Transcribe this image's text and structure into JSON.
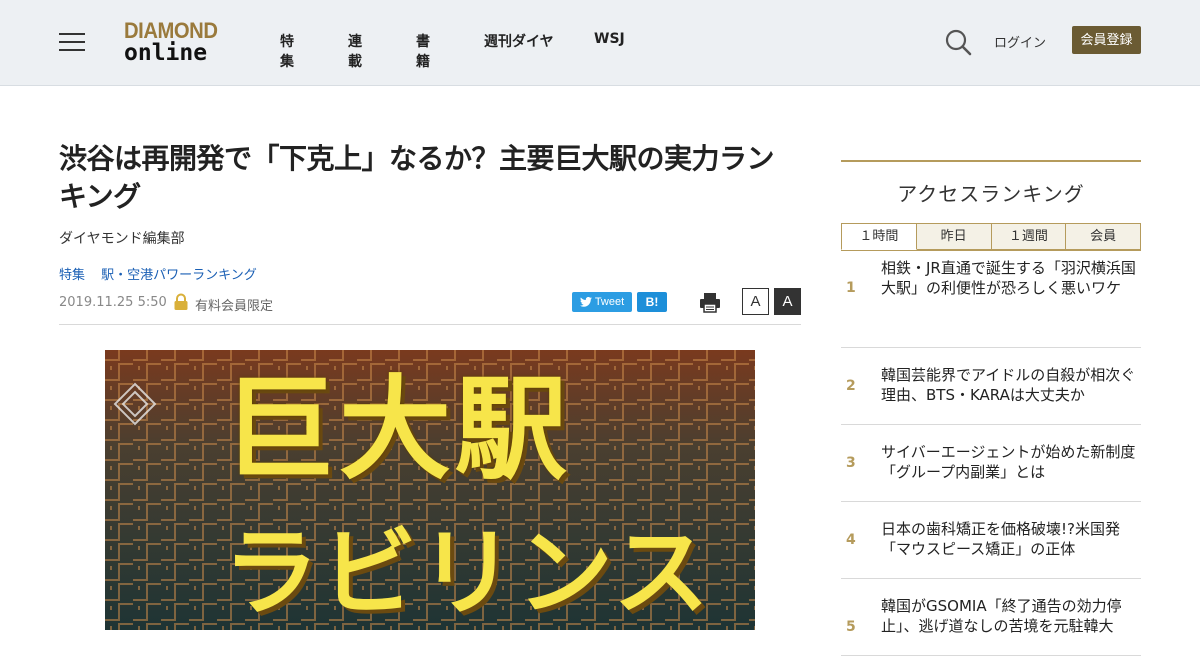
{
  "header": {
    "logo_line1": "DIAMOND",
    "logo_line2": "online",
    "nav": [
      "特集",
      "連載",
      "書籍",
      "週刊ダイヤ",
      "WSJ"
    ],
    "login_label": "ログイン",
    "register_label": "会員登録"
  },
  "article": {
    "title": "渋谷は再開発で「下克上」なるか？主要巨大駅の実力ランキング",
    "author": "ダイヤモンド編集部",
    "tags": [
      "特集",
      "駅・空港パワーランキング"
    ],
    "date": "2019.11.25 5:50",
    "members_only": "有料会員限定",
    "tweet_label": "Tweet",
    "hatena_label": "B!",
    "font_small": "A",
    "font_large": "A",
    "hero_line1": "巨大駅",
    "hero_line2": "ラビリンス"
  },
  "ranking": {
    "title": "アクセスランキング",
    "tabs": [
      "１時間",
      "昨日",
      "１週間",
      "会員"
    ],
    "items": [
      {
        "num": "1",
        "text": "相鉄・JR直通で誕生する「羽沢横浜国大駅」の利便性が恐ろしく悪いワケ"
      },
      {
        "num": "2",
        "text": "韓国芸能界でアイドルの自殺が相次ぐ理由、BTS・KARAは大丈夫か"
      },
      {
        "num": "3",
        "text": "サイバーエージェントが始めた新制度「グループ内副業」とは"
      },
      {
        "num": "4",
        "text": "日本の歯科矯正を価格破壊!?米国発「マウスピース矯正」の正体"
      },
      {
        "num": "5",
        "text": "韓国がGSOMIA「終了通告の効力停止」、逃げ道なしの苦境を元駐韓大"
      }
    ]
  },
  "colors": {
    "accent_gold": "#b59b5c",
    "register_bg": "#6b5b33",
    "tweet_blue": "#2c9de3",
    "hatena_blue": "#1d8fd9",
    "tag_blue": "#1a5fb4",
    "hero_yellow": "#f7e54a"
  }
}
